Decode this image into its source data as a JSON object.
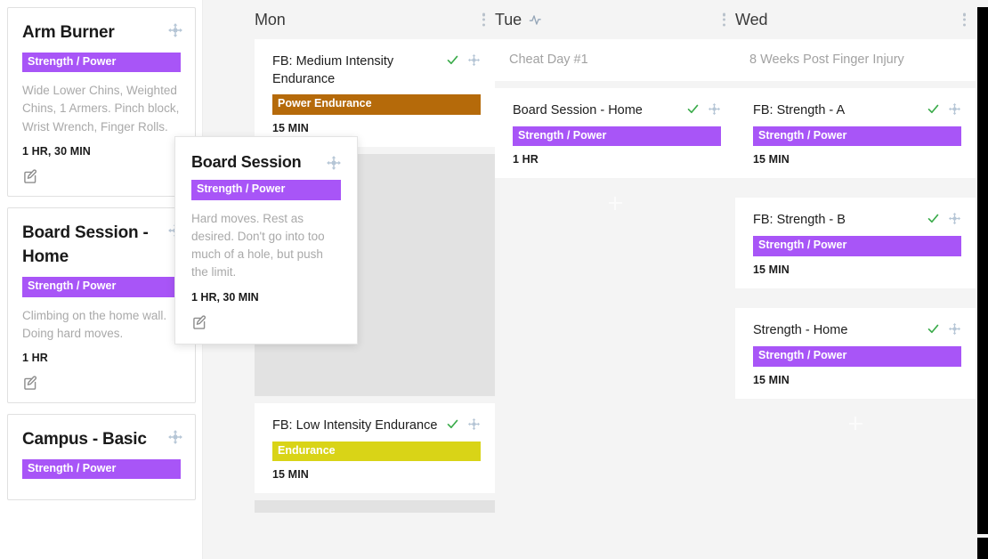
{
  "colors": {
    "tag_strength": "#a855f7",
    "tag_power_endurance": "#b56a0a",
    "tag_endurance": "#d9d417",
    "check_green": "#3aab4a",
    "board_bg": "#f4f4f4",
    "placeholder_gray": "#e2e2e2",
    "scrollbar": "#000000"
  },
  "library": {
    "cards": [
      {
        "title": "Arm Burner",
        "tag": "Strength / Power",
        "tag_color": "#a855f7",
        "description": "Wide Lower Chins, Weighted Chins, 1 Armers. Pinch block, Wrist Wrench, Finger Rolls.",
        "duration": "1 HR, 30 MIN",
        "drag_icon": "move-handle-icon",
        "edit_icon": "edit-pencil-icon"
      },
      {
        "title": "Board Session - Home",
        "tag": "Strength / Power",
        "tag_color": "#a855f7",
        "description": "Climbing on the home wall. Doing hard moves.",
        "duration": "1 HR",
        "drag_icon": "move-handle-icon",
        "edit_icon": "edit-pencil-icon"
      },
      {
        "title": "Campus - Basic",
        "tag": "Strength / Power",
        "tag_color": "#a855f7",
        "description": "",
        "duration": "",
        "drag_icon": "move-handle-icon",
        "edit_icon": "edit-pencil-icon"
      }
    ]
  },
  "drag_ghost": {
    "title": "Board Session",
    "tag": "Strength / Power",
    "tag_color": "#a855f7",
    "description": "Hard moves. Rest as desired. Don't go into too much of a hole, but push the limit.",
    "duration": "1 HR, 30 MIN",
    "drag_icon": "move-handle-icon",
    "edit_icon": "edit-pencil-icon"
  },
  "board": {
    "columns": [
      {
        "day": "Mon",
        "has_pulse_icon": false,
        "menu_icon": "kebab-menu-icon",
        "note": null,
        "cards": [
          {
            "title": "FB: Medium Intensity Endurance",
            "tag": "Power Endurance",
            "tag_color": "#b56a0a",
            "duration": "15 MIN",
            "checked": true
          }
        ],
        "placeholder": true,
        "cards_after": [
          {
            "title": "FB: Low Intensity Endurance",
            "tag": "Endurance",
            "tag_color": "#d9d417",
            "duration": "15 MIN",
            "checked": true
          }
        ],
        "add_label": "+"
      },
      {
        "day": "Tue",
        "has_pulse_icon": true,
        "pulse_icon": "activity-pulse-icon",
        "menu_icon": "kebab-menu-icon",
        "note": "Cheat Day #1",
        "cards": [
          {
            "title": "Board Session - Home",
            "tag": "Strength / Power",
            "tag_color": "#a855f7",
            "duration": "1 HR",
            "checked": true
          }
        ],
        "placeholder": false,
        "cards_after": [],
        "add_label": "+"
      },
      {
        "day": "Wed",
        "has_pulse_icon": false,
        "menu_icon": "kebab-menu-icon",
        "note": "8 Weeks Post Finger Injury",
        "cards": [
          {
            "title": "FB: Strength - A",
            "tag": "Strength / Power",
            "tag_color": "#a855f7",
            "duration": "15 MIN",
            "checked": true
          },
          {
            "title": "FB: Strength - B",
            "tag": "Strength / Power",
            "tag_color": "#a855f7",
            "duration": "15 MIN",
            "checked": true
          },
          {
            "title": "Strength - Home",
            "tag": "Strength / Power",
            "tag_color": "#a855f7",
            "duration": "15 MIN",
            "checked": true
          }
        ],
        "placeholder": false,
        "cards_after": [],
        "add_label": "+"
      }
    ]
  }
}
